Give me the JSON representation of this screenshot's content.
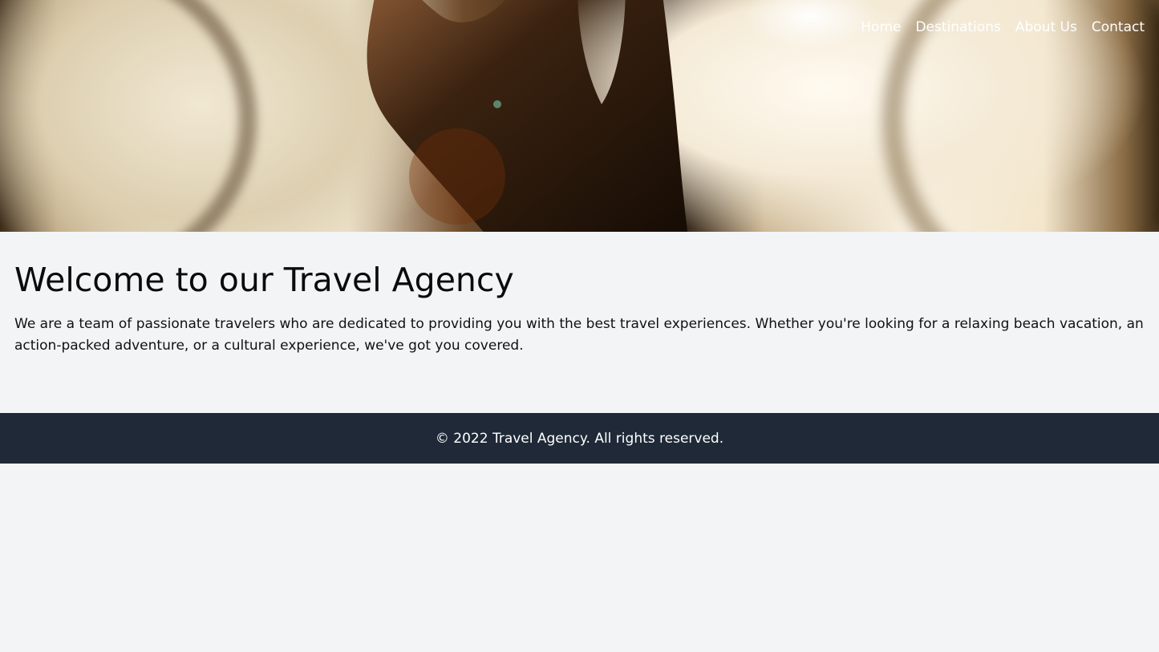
{
  "nav": {
    "items": [
      {
        "label": "Home"
      },
      {
        "label": "Destinations"
      },
      {
        "label": "About Us"
      },
      {
        "label": "Contact"
      }
    ]
  },
  "main": {
    "title": "Welcome to our Travel Agency",
    "description": "We are a team of passionate travelers who are dedicated to providing you with the best travel experiences. Whether you're looking for a relaxing beach vacation, an action-packed adventure, or a cultural experience, we've got you covered."
  },
  "footer": {
    "copyright": "© 2022 Travel Agency. All rights reserved."
  },
  "colors": {
    "background": "#f3f4f6",
    "footer": "#1f2937",
    "nav_text": "#ffffff"
  }
}
